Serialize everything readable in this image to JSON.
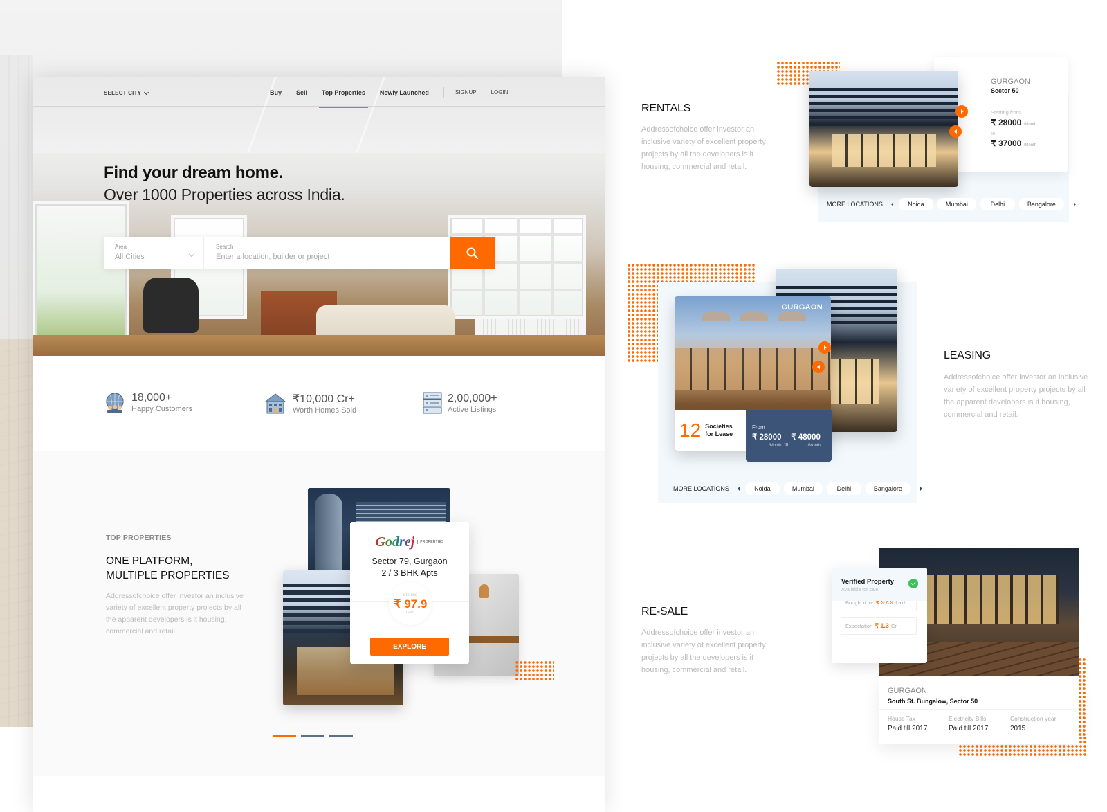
{
  "nav": {
    "city_select": "SELECT CITY",
    "links": [
      "Buy",
      "Sell",
      "Top Properties",
      "Newly Launched"
    ],
    "active_link": "Top Properties",
    "signup": "SIGNUP",
    "login": "LOGIN"
  },
  "hero": {
    "title": "Find your dream home.",
    "subtitle": "Over 1000 Properties across India."
  },
  "search": {
    "area_label": "Area",
    "area_value": "All Cities",
    "search_label": "Search",
    "search_placeholder": "Enter a location, builder or project",
    "search_value": ""
  },
  "stats": [
    {
      "icon": "globe-people-icon",
      "value": "18,000+",
      "caption": "Happy Customers"
    },
    {
      "icon": "building-icon",
      "value": "₹10,000 Cr+",
      "caption": "Worth Homes Sold"
    },
    {
      "icon": "listings-icon",
      "value": "2,00,000+",
      "caption": "Active Listings"
    }
  ],
  "top_properties": {
    "kicker": "TOP PROPERTIES",
    "heading_line1": "ONE PLATFORM,",
    "heading_line2": "MULTIPLE PROPERTIES",
    "description": "Addressofchoice offer investor an inclusive variety of excellent property projects by all the apparent developers is it housing, commercial and retail.",
    "card": {
      "brand": "Godrej",
      "brand_sub": "PROPERTIES",
      "location": "Sector 79, Gurgaon",
      "config": "2 / 3 BHK Apts",
      "starting_label": "Starting",
      "price": "₹ 97.9",
      "unit": "Lakh",
      "cta": "EXPLORE"
    },
    "pager": {
      "count": 3,
      "active": 1
    }
  },
  "rentals": {
    "title": "RENTALS",
    "description": "Addressofchoice offer investor an inclusive variety of excellent property projects by all the  developers is it housing, commercial and retail.",
    "card": {
      "city": "GURGAON",
      "sector": "Sector 50",
      "starting_from": "Starting from",
      "price_from": "₹ 28000",
      "to": "to",
      "price_to": "₹ 37000",
      "per": "/Month"
    },
    "more_locations_label": "MORE LOCATIONS",
    "locations": [
      "Noida",
      "Mumbai",
      "Delhi",
      "Bangalore"
    ]
  },
  "leasing": {
    "title": "LEASING",
    "description": "Addressofchoice offer investor an inclusive variety of excellent property projects by all the apparent developers is it housing, commercial and retail.",
    "card": {
      "city": "GURGAON",
      "count": "12",
      "count_label_1": "Societies",
      "count_label_2": "for Lease",
      "from_label": "From",
      "price_from": "₹ 28000",
      "to": "to",
      "price_to": "₹ 48000",
      "per": "/Month"
    },
    "more_locations_label": "MORE LOCATIONS",
    "locations": [
      "Noida",
      "Mumbai",
      "Delhi",
      "Bangalore"
    ]
  },
  "resale": {
    "title": "RE-SALE",
    "description": "Addressofchoice offer investor an inclusive variety of excellent property projects by all the  developers is it housing, commercial and retail.",
    "verified": {
      "title": "Verified Property",
      "subtitle": "Available for sale",
      "bought_label": "Bought it for",
      "bought_value": "₹ 97.9",
      "bought_unit": "Lakh",
      "expectation_label": "Expectation",
      "expectation_value": "₹ 1.3",
      "expectation_unit": "Cr"
    },
    "info": {
      "city": "GURGAON",
      "name": "South St. Bungalow, Sector 50",
      "details": [
        {
          "label": "House Tax",
          "value": "Paid till 2017"
        },
        {
          "label": "Electricity Bills",
          "value": "Paid till 2017"
        },
        {
          "label": "Construction year",
          "value": "2015"
        }
      ]
    }
  },
  "colors": {
    "accent": "#ff6a00",
    "navy": "#3c5478",
    "panel": "#f2f8fc",
    "success": "#3cc15a"
  }
}
